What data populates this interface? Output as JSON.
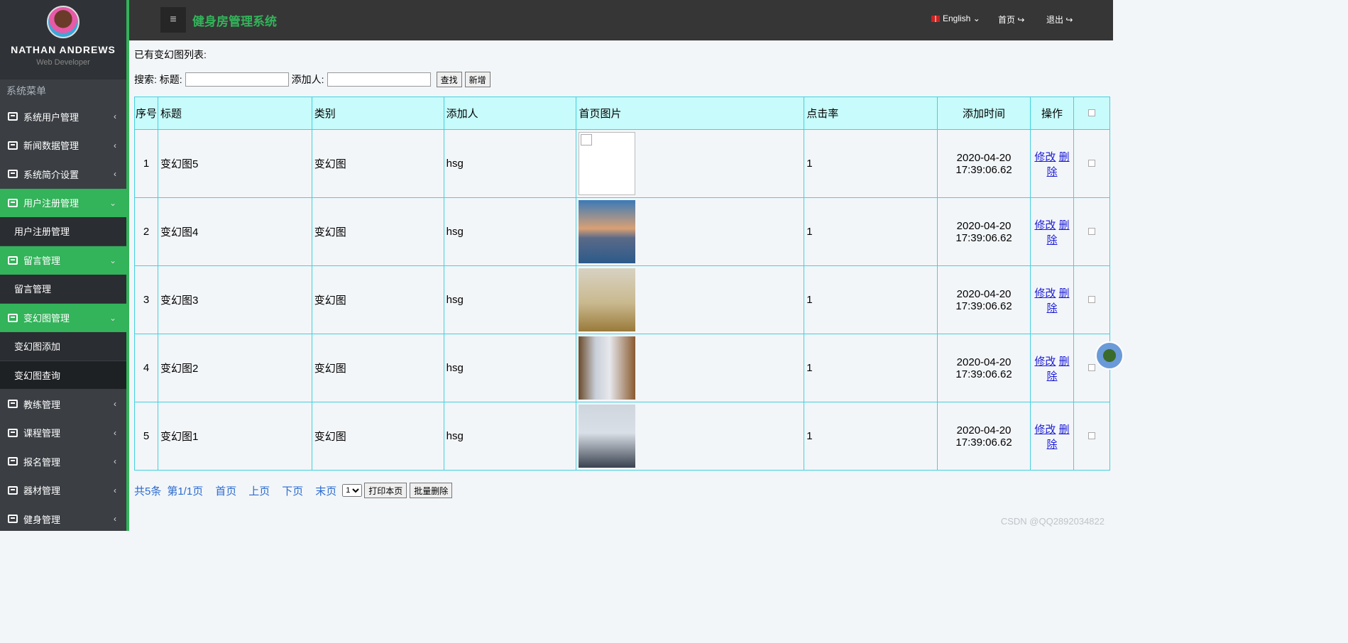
{
  "profile": {
    "name": "NATHAN ANDREWS",
    "role": "Web Developer"
  },
  "sidebar": {
    "menu_title": "系统菜单",
    "items": [
      {
        "label": "系统用户管理",
        "active": false,
        "chev": "‹"
      },
      {
        "label": "新闻数据管理",
        "active": false,
        "chev": "‹"
      },
      {
        "label": "系统简介设置",
        "active": false,
        "chev": "‹"
      },
      {
        "label": "用户注册管理",
        "active": true,
        "chev": "⌄",
        "sub": [
          "用户注册管理"
        ]
      },
      {
        "label": "留言管理",
        "active": true,
        "chev": "⌄",
        "sub": [
          "留言管理"
        ]
      },
      {
        "label": "变幻图管理",
        "active": true,
        "chev": "⌄",
        "sub": [
          "变幻图添加",
          "变幻图查询"
        ]
      },
      {
        "label": "教练管理",
        "active": false,
        "chev": "‹"
      },
      {
        "label": "课程管理",
        "active": false,
        "chev": "‹"
      },
      {
        "label": "报名管理",
        "active": false,
        "chev": "‹"
      },
      {
        "label": "器材管理",
        "active": false,
        "chev": "‹"
      },
      {
        "label": "健身管理",
        "active": false,
        "chev": "‹"
      }
    ]
  },
  "header": {
    "title": "健身房管理系统",
    "hamburger": "≡",
    "language": "English",
    "home": "首页",
    "logout": "退出"
  },
  "main": {
    "list_title": "已有变幻图列表:",
    "search_label": "搜索: 标题:",
    "adder_label": "添加人:",
    "find_button": "查找",
    "add_button": "新增",
    "columns": [
      "序号",
      "标题",
      "类别",
      "添加人",
      "首页图片",
      "点击率",
      "添加时间",
      "操作",
      ""
    ],
    "rows": [
      {
        "no": "1",
        "title": "变幻图5",
        "category": "变幻图",
        "adder": "hsg",
        "clicks": "1",
        "time": "2020-04-20 17:39:06.62"
      },
      {
        "no": "2",
        "title": "变幻图4",
        "category": "变幻图",
        "adder": "hsg",
        "clicks": "1",
        "time": "2020-04-20 17:39:06.62"
      },
      {
        "no": "3",
        "title": "变幻图3",
        "category": "变幻图",
        "adder": "hsg",
        "clicks": "1",
        "time": "2020-04-20 17:39:06.62"
      },
      {
        "no": "4",
        "title": "变幻图2",
        "category": "变幻图",
        "adder": "hsg",
        "clicks": "1",
        "time": "2020-04-20 17:39:06.62"
      },
      {
        "no": "5",
        "title": "变幻图1",
        "category": "变幻图",
        "adder": "hsg",
        "clicks": "1",
        "time": "2020-04-20 17:39:06.62"
      }
    ],
    "edit_label": "修改",
    "delete_label": "删除"
  },
  "pager": {
    "total": "共5条",
    "page": "第1/1页",
    "first": "首页",
    "prev": "上页",
    "next": "下页",
    "last": "末页",
    "select_value": "1",
    "print_button": "打印本页",
    "batch_delete_button": "批量删除"
  },
  "watermark": "CSDN @QQ2892034822"
}
